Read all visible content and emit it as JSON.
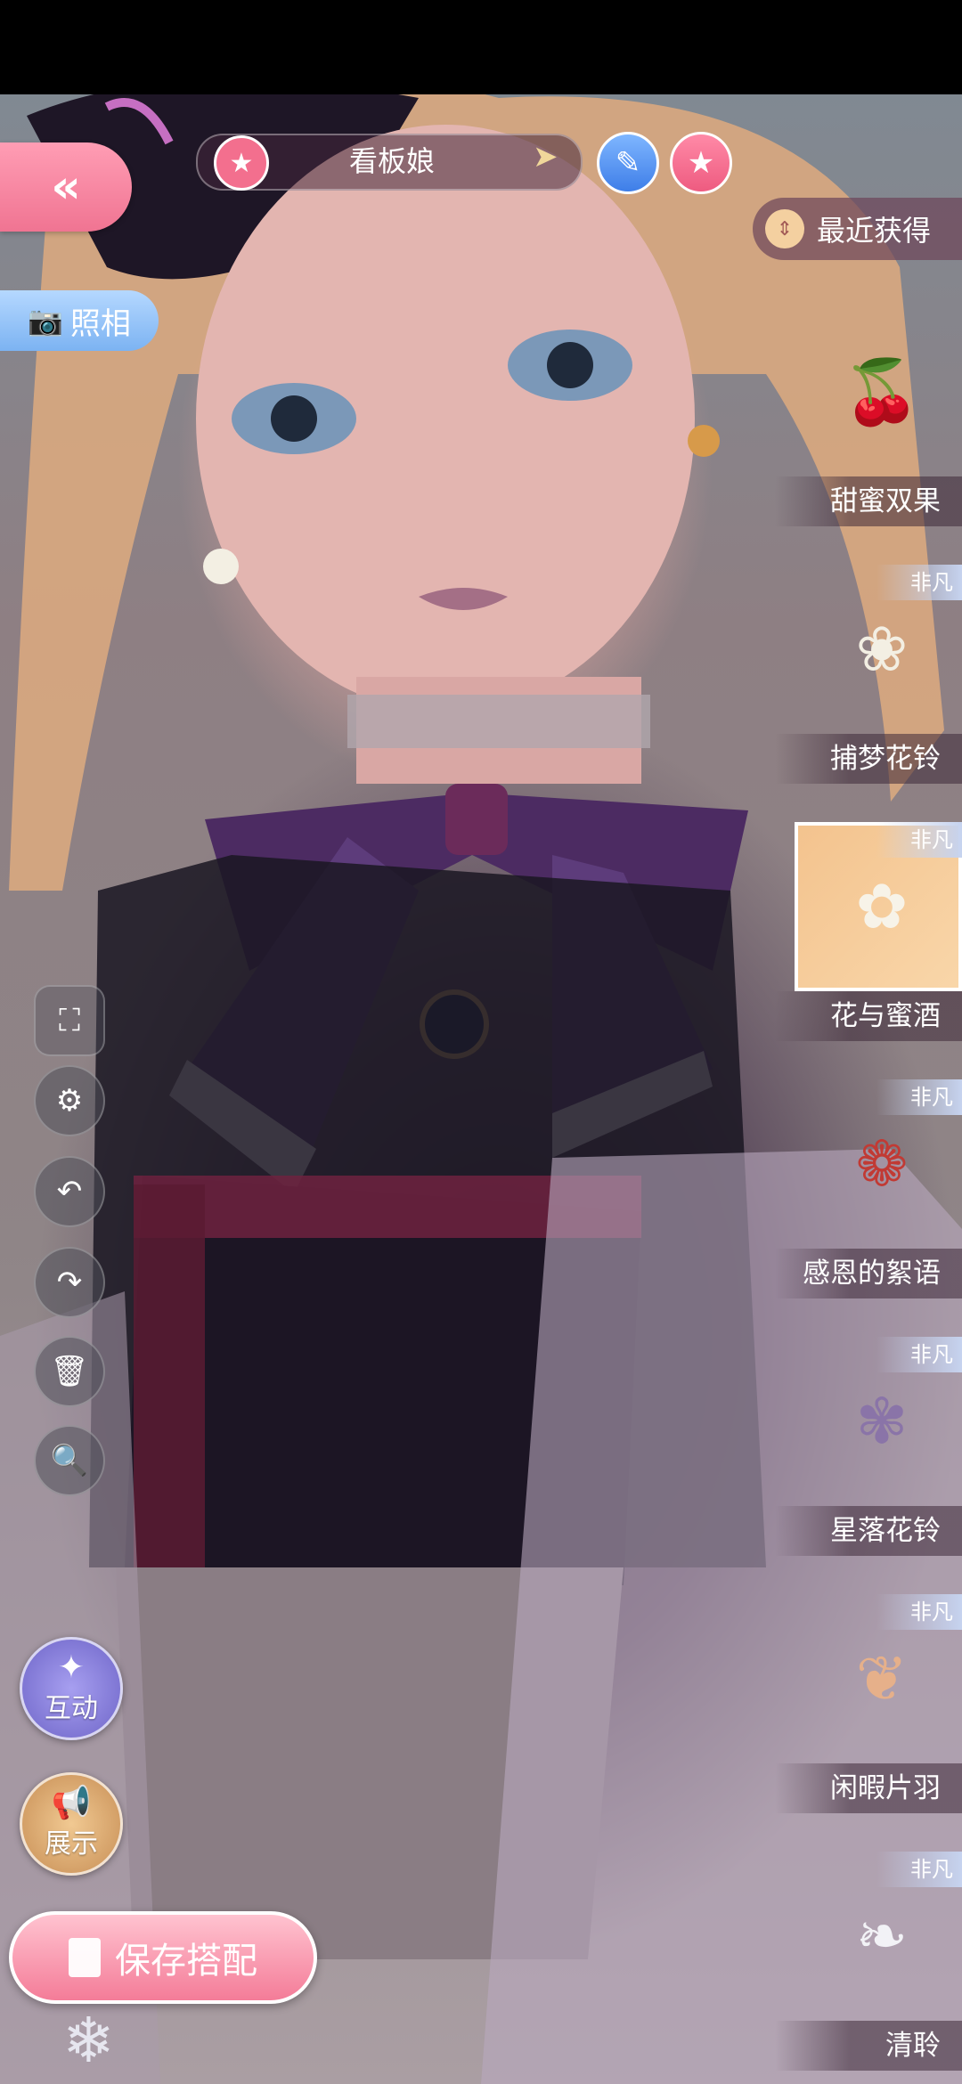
{
  "header": {
    "back_label": "«",
    "name_label": "看板娘",
    "star_glyph": "★",
    "arrow_glyph": "➤",
    "edit_glyph": "✎",
    "fav_glyph": "★"
  },
  "photo": {
    "label": "照相",
    "icon": "camera-icon"
  },
  "sort": {
    "label": "最近获得",
    "icon": "sort-icon"
  },
  "tools": {
    "fullscreen": "⛶",
    "settings": "⚙",
    "undo": "↶",
    "redo": "↷",
    "delete": "🗑",
    "zoom": "🔍"
  },
  "actions": {
    "interact_label": "互动",
    "interact_glyph": "✦",
    "showcase_label": "展示",
    "showcase_glyph": "📢",
    "save_label": "保存搭配",
    "crystal_glyph": "❄"
  },
  "items": [
    {
      "name": "甜蜜双果",
      "badge": "",
      "icon": "🍒",
      "selected": false
    },
    {
      "name": "捕梦花铃",
      "badge": "非凡",
      "icon": "❀",
      "selected": false
    },
    {
      "name": "花与蜜酒",
      "badge": "非凡",
      "icon": "✿",
      "selected": true
    },
    {
      "name": "感恩的絮语",
      "badge": "非凡",
      "icon": "❁",
      "selected": false
    },
    {
      "name": "星落花铃",
      "badge": "非凡",
      "icon": "✾",
      "selected": false
    },
    {
      "name": "闲暇片羽",
      "badge": "非凡",
      "icon": "❦",
      "selected": false
    },
    {
      "name": "清聆",
      "badge": "非凡",
      "icon": "❧",
      "selected": false
    }
  ],
  "colors": {
    "accent_pink": "#f07492",
    "accent_blue": "#7cb3f2",
    "selected_item_bg": "#f3c38e"
  }
}
